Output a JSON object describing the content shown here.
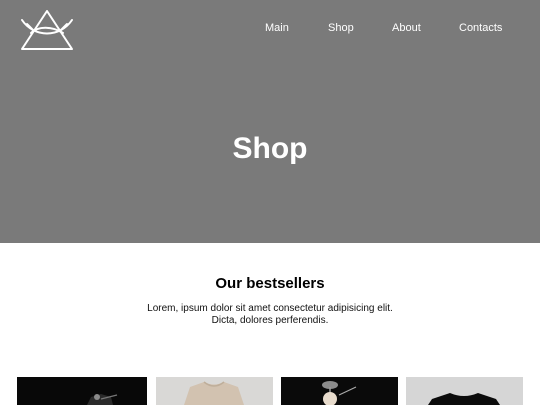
{
  "nav": {
    "items": [
      {
        "label": "Main"
      },
      {
        "label": "Shop"
      },
      {
        "label": "About"
      },
      {
        "label": "Contacts"
      }
    ]
  },
  "hero": {
    "title": "Shop"
  },
  "bestsellers": {
    "title": "Our bestsellers",
    "description_line1": "Lorem, ipsum dolor sit amet consectetur adipisicing elit.",
    "description_line2": "Dicta, dolores perferendis."
  },
  "colors": {
    "hero_bg": "#7a7a7a",
    "page_bg": "#ffffff",
    "nav_text": "#ffffff"
  },
  "icons": {
    "logo": "triangle-eye-logo-icon"
  }
}
